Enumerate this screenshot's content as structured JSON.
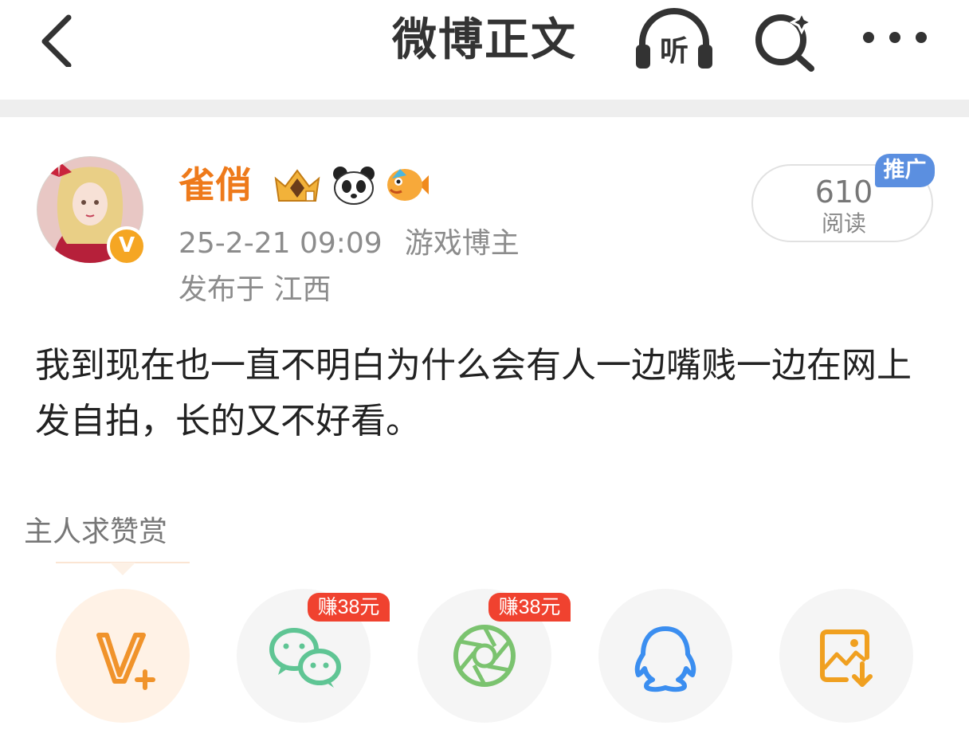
{
  "header": {
    "title": "微博正文",
    "listen_label": "听"
  },
  "post": {
    "author": {
      "name": "雀俏",
      "badges": [
        "crown-badge-icon",
        "panda-badge-icon",
        "fish-badge-icon"
      ],
      "verified_label": "V"
    },
    "timestamp": "25-2-21 09:09",
    "author_tag": "游戏博主",
    "location": "发布于 江西",
    "read_count": "610",
    "read_label": "阅读",
    "promo_tag": "推广",
    "text": "我到现在也一直不明白为什么会有人一边嘴贱一边在网上发自拍，长的又不好看。"
  },
  "reward": {
    "label": "主人求赞赏"
  },
  "share": {
    "earn_tag_wechat": "赚38元",
    "earn_tag_moments": "赚38元"
  },
  "colors": {
    "accent": "#ee7a1b",
    "promo": "#5b8fe0",
    "earn_tag": "#f0422f",
    "wechat": "#5fc594",
    "moments": "#7bc36f",
    "qq": "#3b8ef0",
    "save": "#f0a020"
  }
}
